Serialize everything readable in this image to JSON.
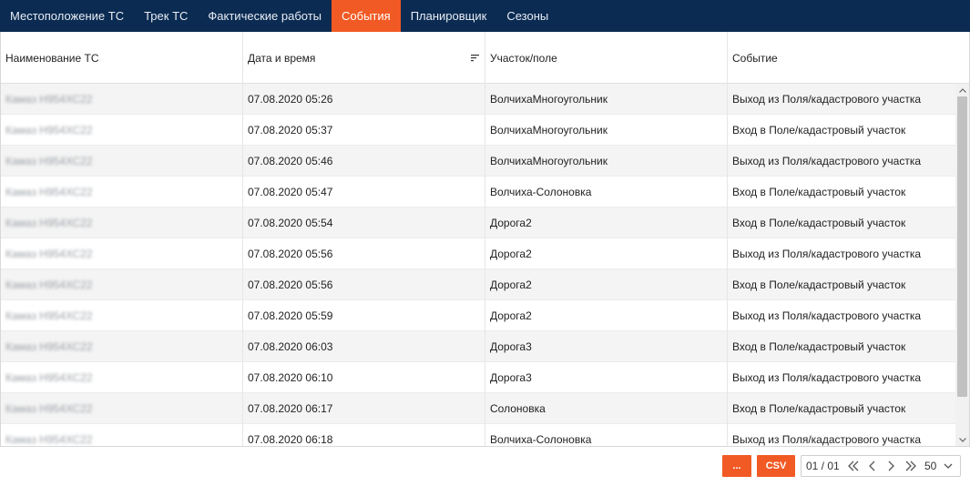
{
  "nav": {
    "tabs": [
      {
        "label": "Местоположение ТС",
        "active": false
      },
      {
        "label": "Трек ТС",
        "active": false
      },
      {
        "label": "Фактические работы",
        "active": false
      },
      {
        "label": "События",
        "active": true
      },
      {
        "label": "Планировщик",
        "active": false
      },
      {
        "label": "Сезоны",
        "active": false
      }
    ]
  },
  "table": {
    "columns": [
      "Наименование ТС",
      "Дата и время",
      "Участок/поле",
      "Событие"
    ],
    "sort_icon": "sort-descending-icon",
    "rows": [
      {
        "vehicle": "Камаз Н954ХС22",
        "datetime": "07.08.2020 05:26",
        "field": "ВолчихаМногоугольник",
        "event": "Выход из Поля/кадастрового участка"
      },
      {
        "vehicle": "Камаз Н954ХС22",
        "datetime": "07.08.2020 05:37",
        "field": "ВолчихаМногоугольник",
        "event": "Вход в Поле/кадастровый участок"
      },
      {
        "vehicle": "Камаз Н954ХС22",
        "datetime": "07.08.2020 05:46",
        "field": "ВолчихаМногоугольник",
        "event": "Выход из Поля/кадастрового участка"
      },
      {
        "vehicle": "Камаз Н954ХС22",
        "datetime": "07.08.2020 05:47",
        "field": "Волчиха-Солоновка",
        "event": "Вход в Поле/кадастровый участок"
      },
      {
        "vehicle": "Камаз Н954ХС22",
        "datetime": "07.08.2020 05:54",
        "field": "Дорога2",
        "event": "Вход в Поле/кадастровый участок"
      },
      {
        "vehicle": "Камаз Н954ХС22",
        "datetime": "07.08.2020 05:56",
        "field": "Дорога2",
        "event": "Выход из Поля/кадастрового участка"
      },
      {
        "vehicle": "Камаз Н954ХС22",
        "datetime": "07.08.2020 05:56",
        "field": "Дорога2",
        "event": "Вход в Поле/кадастровый участок"
      },
      {
        "vehicle": "Камаз Н954ХС22",
        "datetime": "07.08.2020 05:59",
        "field": "Дорога2",
        "event": "Выход из Поля/кадастрового участка"
      },
      {
        "vehicle": "Камаз Н954ХС22",
        "datetime": "07.08.2020 06:03",
        "field": "Дорога3",
        "event": "Вход в Поле/кадастровый участок"
      },
      {
        "vehicle": "Камаз Н954ХС22",
        "datetime": "07.08.2020 06:10",
        "field": "Дорога3",
        "event": "Выход из Поля/кадастрового участка"
      },
      {
        "vehicle": "Камаз Н954ХС22",
        "datetime": "07.08.2020 06:17",
        "field": "Солоновка",
        "event": "Вход в Поле/кадастровый участок"
      },
      {
        "vehicle": "Камаз Н954ХС22",
        "datetime": "07.08.2020 06:18",
        "field": "Волчиха-Солоновка",
        "event": "Выход из Поля/кадастрового участка"
      }
    ]
  },
  "footer": {
    "more_label": "...",
    "csv_label": "CSV",
    "page_indicator": "01 / 01",
    "page_size": "50"
  },
  "colors": {
    "nav_background": "#0b2b52",
    "accent": "#f15a24"
  }
}
